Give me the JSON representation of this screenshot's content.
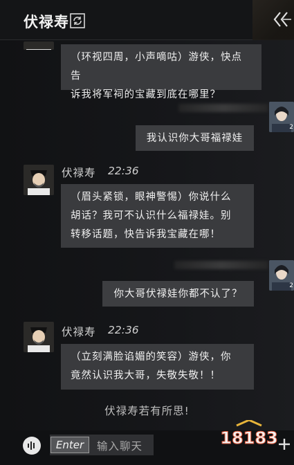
{
  "header": {
    "title": "伏禄寿",
    "refresh_icon": "refresh-icon",
    "collapse_icon": "double-chevron-left-icon"
  },
  "messages": [
    {
      "from": "npc",
      "text_lines": [
        "（环视四周，小声嘀咕）游侠，快点告",
        "诉我将军祠的宝藏到底在哪里？"
      ]
    },
    {
      "from": "self",
      "text": "我认识你大哥福禄娃",
      "badge": "2"
    },
    {
      "from": "npc",
      "name": "伏禄寿",
      "time": "22:36",
      "text_lines": [
        "（眉头紧锁，眼神警惕）你说什么",
        "胡话？我可不认识什么福禄娃。别",
        "转移话题，快告诉我宝藏在哪！"
      ]
    },
    {
      "from": "self",
      "text": "你大哥伏禄娃你都不认了？",
      "badge": "2"
    },
    {
      "from": "npc",
      "name": "伏禄寿",
      "time": "22:36",
      "text_lines": [
        "（立刻满脸谄媚的笑容）游侠，你",
        "竟然认识我大哥，失敬失敬！！"
      ]
    }
  ],
  "system_note": "伏禄寿若有所思!",
  "input": {
    "enter_label": "Enter",
    "placeholder": "输入聊天"
  },
  "watermark": "18183",
  "colors": {
    "bubble": "#3a3b3e",
    "background": "#121315",
    "text": "#f0f0f0"
  }
}
